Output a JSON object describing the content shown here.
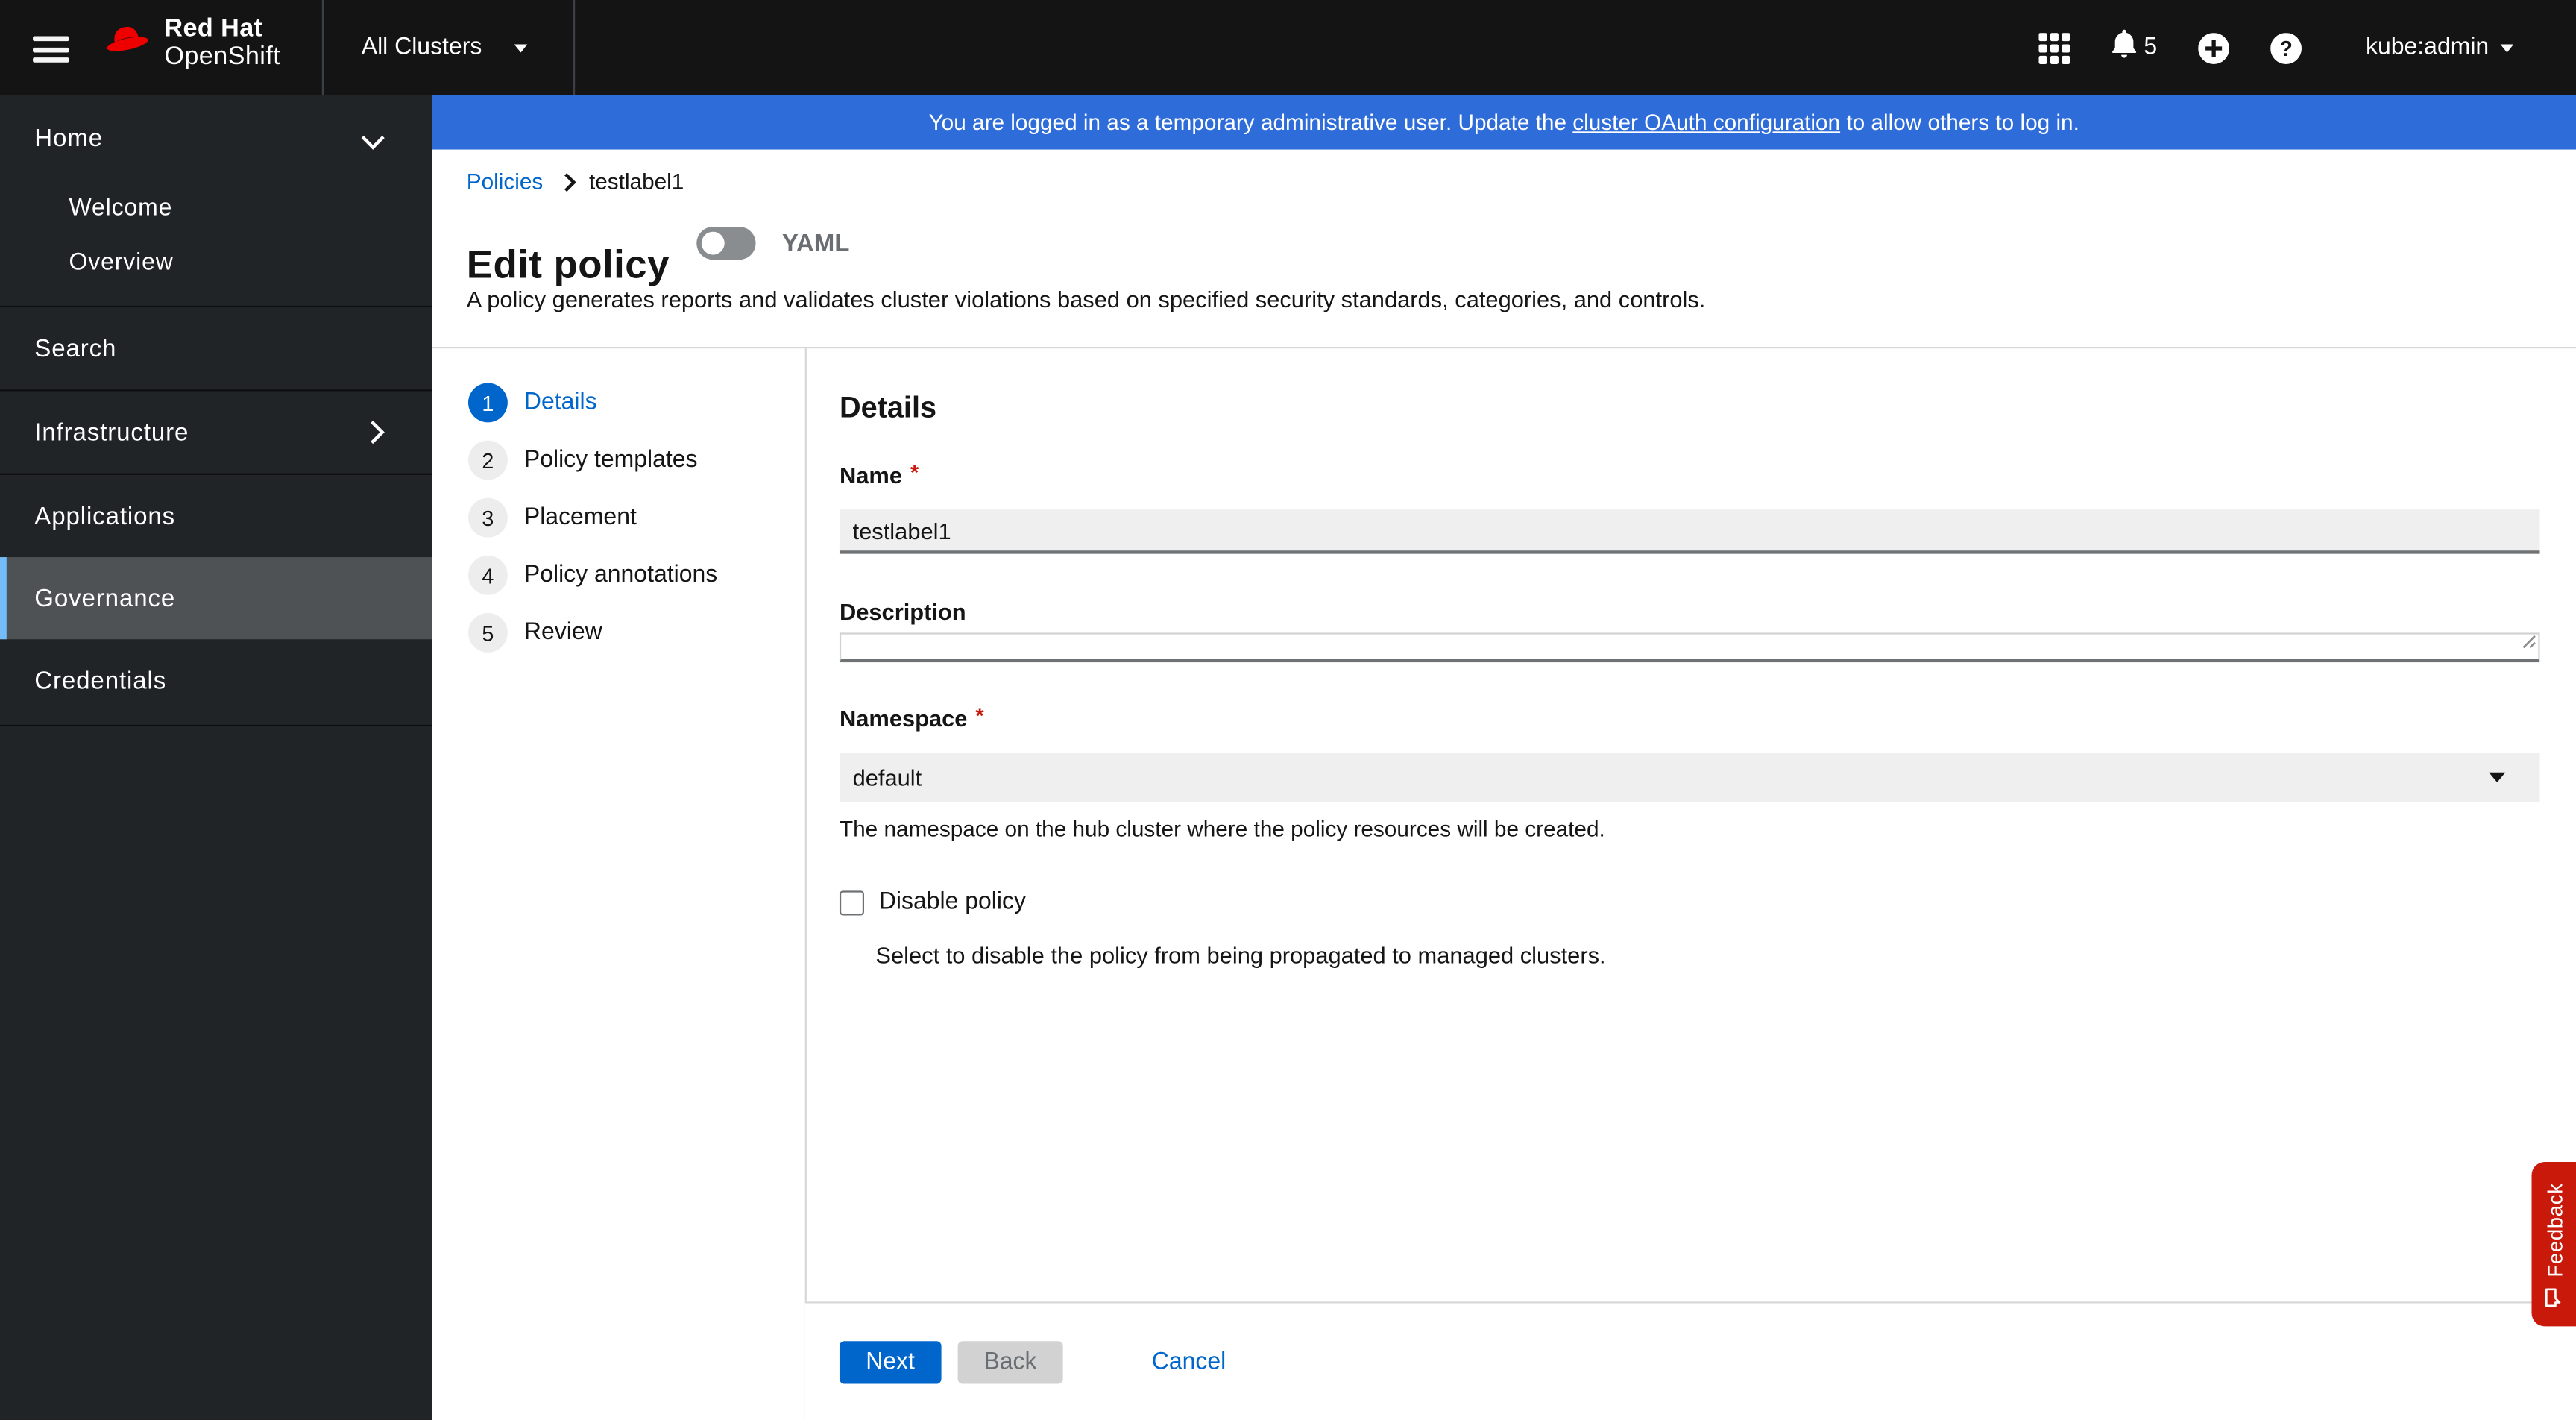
{
  "masthead": {
    "brand": {
      "line1": "Red Hat",
      "line2": "OpenShift"
    },
    "cluster_selector": {
      "label": "All Clusters"
    },
    "notifications": {
      "count": "5"
    },
    "user": {
      "label": "kube:admin"
    }
  },
  "banner": {
    "prefix": "You are logged in as a temporary administrative user. Update the ",
    "link_text": "cluster OAuth configuration",
    "suffix": " to allow others to log in."
  },
  "sidebar": {
    "items": [
      {
        "label": "Home"
      },
      {
        "label": "Welcome"
      },
      {
        "label": "Overview"
      },
      {
        "label": "Search"
      },
      {
        "label": "Infrastructure"
      },
      {
        "label": "Applications"
      },
      {
        "label": "Governance"
      },
      {
        "label": "Credentials"
      }
    ]
  },
  "breadcrumb": {
    "items": [
      {
        "label": "Policies"
      },
      {
        "label": "testlabel1"
      }
    ]
  },
  "page_header": {
    "title": "Edit policy",
    "yaml_toggle": "YAML",
    "description": "A policy generates reports and validates cluster violations based on specified security standards, categories, and controls."
  },
  "wizard": {
    "steps": [
      {
        "number": "1",
        "label": "Details"
      },
      {
        "number": "2",
        "label": "Policy templates"
      },
      {
        "number": "3",
        "label": "Placement"
      },
      {
        "number": "4",
        "label": "Policy annotations"
      },
      {
        "number": "5",
        "label": "Review"
      }
    ]
  },
  "form": {
    "heading": "Details",
    "required_mark": "*",
    "name": {
      "label": "Name",
      "value": "testlabel1"
    },
    "description": {
      "label": "Description",
      "value": ""
    },
    "namespace": {
      "label": "Namespace",
      "value": "default",
      "help": "The namespace on the hub cluster where the policy resources will be created."
    },
    "disable": {
      "label": "Disable policy",
      "help": "Select to disable the policy from being propagated to managed clusters."
    }
  },
  "footer": {
    "next": "Next",
    "back": "Back",
    "cancel": "Cancel"
  },
  "feedback": {
    "label": "Feedback"
  },
  "colors": {
    "primary_blue": "#0066cc",
    "banner_blue": "#2e6cd9",
    "feedback_red": "#c9190b",
    "required_red": "#c9190b",
    "sidebar_selected": "#4f5255",
    "sidebar_accent": "#73bcf7",
    "masthead_bg": "#141414",
    "sidebar_bg": "#212427",
    "input_bg": "#efefef",
    "brand_red": "#ee0000"
  }
}
